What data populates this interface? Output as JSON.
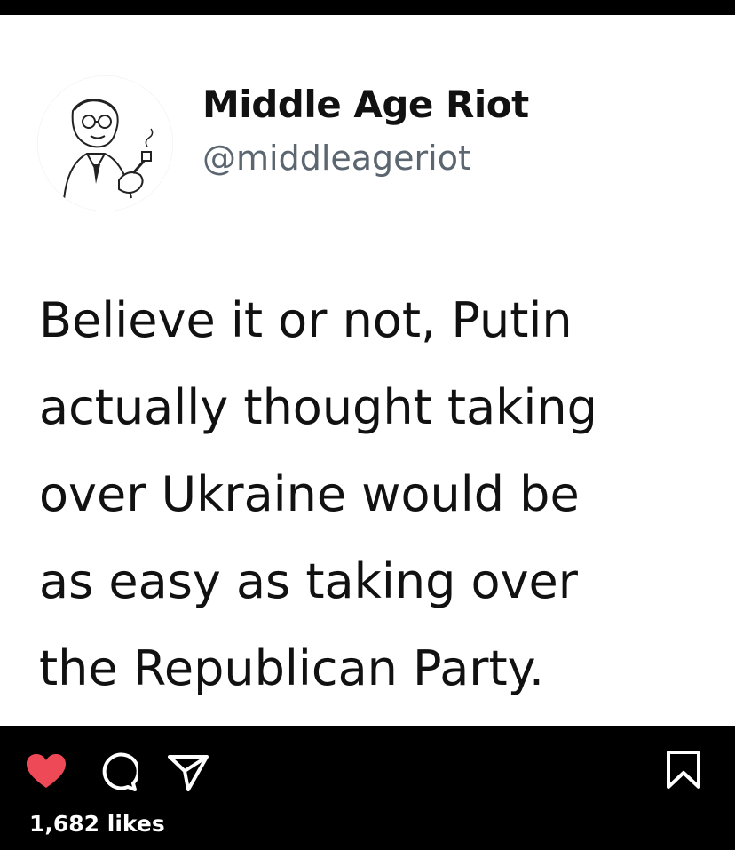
{
  "tweet": {
    "display_name": "Middle Age Riot",
    "handle": "@middleageriot",
    "text_lines": [
      "Believe it or not, Putin",
      "actually thought taking",
      "over Ukraine would be",
      "as easy as taking over",
      "the Republican Party."
    ]
  },
  "post": {
    "likes_label": "1,682 likes",
    "liked": true,
    "like_color": "#ed4956"
  },
  "icons": {
    "like": "heart-icon",
    "comment": "comment-icon",
    "share": "share-icon",
    "save": "bookmark-icon"
  }
}
